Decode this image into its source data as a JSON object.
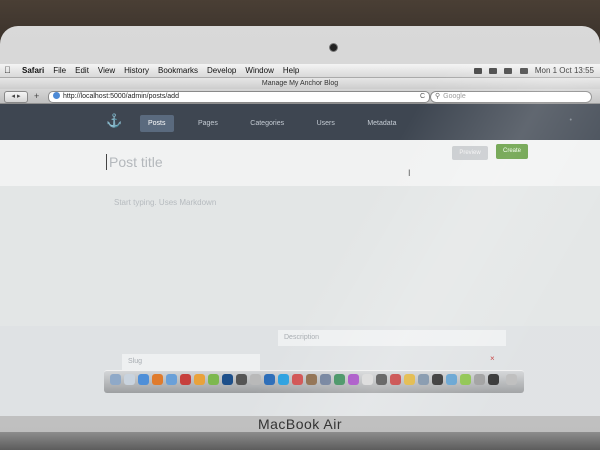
{
  "menubar": {
    "apple_icon": "apple-icon",
    "items": [
      "Safari",
      "File",
      "Edit",
      "View",
      "History",
      "Bookmarks",
      "Develop",
      "Window",
      "Help"
    ],
    "clock": "Mon 1 Oct 13:55"
  },
  "window": {
    "title": "Manage My Anchor Blog"
  },
  "toolbar": {
    "back_label": "◂ ▸",
    "add_label": "+",
    "url": "http://localhost:5000/admin/posts/add",
    "reload_label": "C",
    "search_placeholder": "Google"
  },
  "appnav": {
    "logo_icon": "anchor-icon",
    "links": [
      "Posts",
      "Pages",
      "Categories",
      "Users",
      "Metadata"
    ],
    "active": "Posts"
  },
  "editor": {
    "title_placeholder": "Post title",
    "preview_label": "Preview",
    "create_label": "Create",
    "body_placeholder": "Start typing. Uses Markdown",
    "description_placeholder": "Description",
    "slug_placeholder": "Slug",
    "delete_label": "×"
  },
  "device": {
    "brand": "MacBook Air"
  },
  "colors": {
    "nav_bg": "#3e4651",
    "active_tab": "#5a6a7e",
    "create_button": "#5f9a3b"
  }
}
